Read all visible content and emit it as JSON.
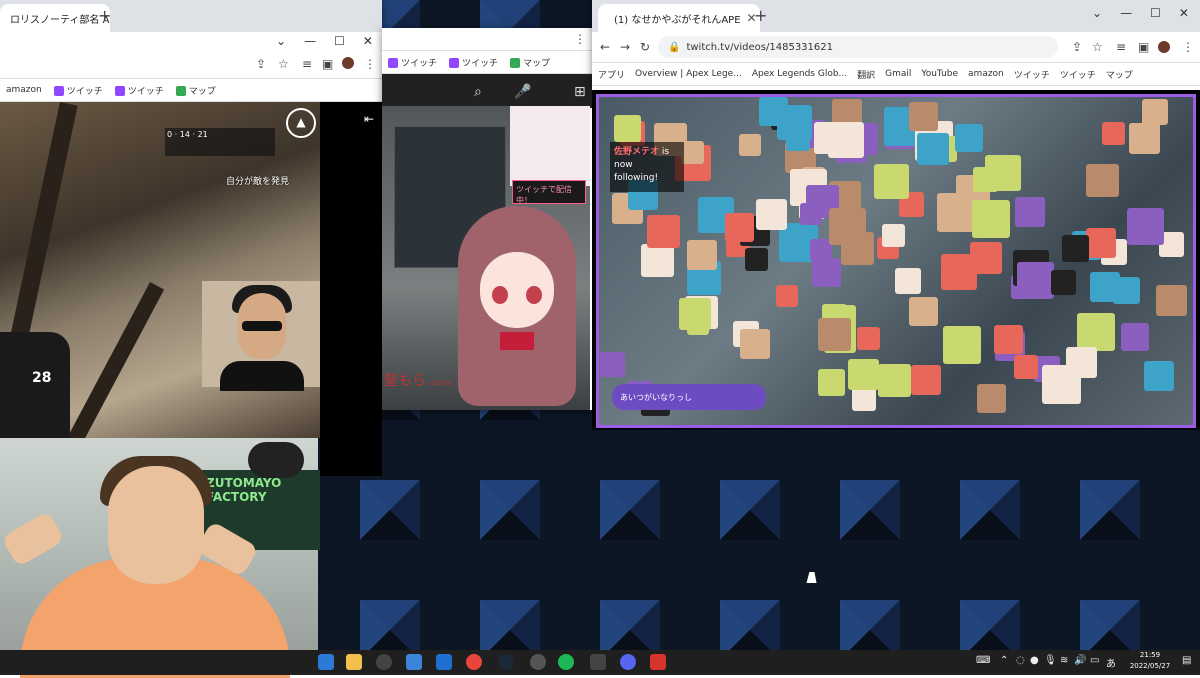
{
  "left_browser": {
    "tab_title": "ロリスノーティ部名 A",
    "bookmarks": [
      "amazon",
      "ツイッチ",
      "ツイッチ",
      "マップ"
    ],
    "game": {
      "callout_text": "自分が敵を発見",
      "ammo": "28",
      "hud_kills": "0",
      "hud_rank": "14",
      "hud_level": "21"
    }
  },
  "middle_browser": {
    "bookmarks": [
      "ツイッチ",
      "ツイッチ",
      "マップ"
    ],
    "stream": {
      "speech_bubble": "ツイッチで配信中！",
      "vtuber_name": "聖もら",
      "vtuber_sub": "mochi"
    }
  },
  "twitch_browser": {
    "tab_title": "(1) なせかやぶがそれんAPE",
    "url": "twitch.tv/videos/1485331621",
    "bookmarks": [
      "アプリ",
      "Overview | Apex Lege...",
      "Apex Legends Glob...",
      "翻訳",
      "Gmail",
      "YouTube",
      "amazon",
      "ツイッチ",
      "ツイッチ",
      "マップ"
    ],
    "follow_notice": {
      "name": "佐野メテオ",
      "text1": "is now",
      "text2": "following!"
    },
    "badge_text": "あいつがいなりっし"
  },
  "taskbar": {
    "tray_lang": "あ",
    "clock_time": "21:59",
    "clock_date": "2022/05/27"
  },
  "colors": {
    "twitch_purple": "#9146ff",
    "overlay_border": "#9b5de5",
    "taskbar": "#1f1f1f"
  }
}
